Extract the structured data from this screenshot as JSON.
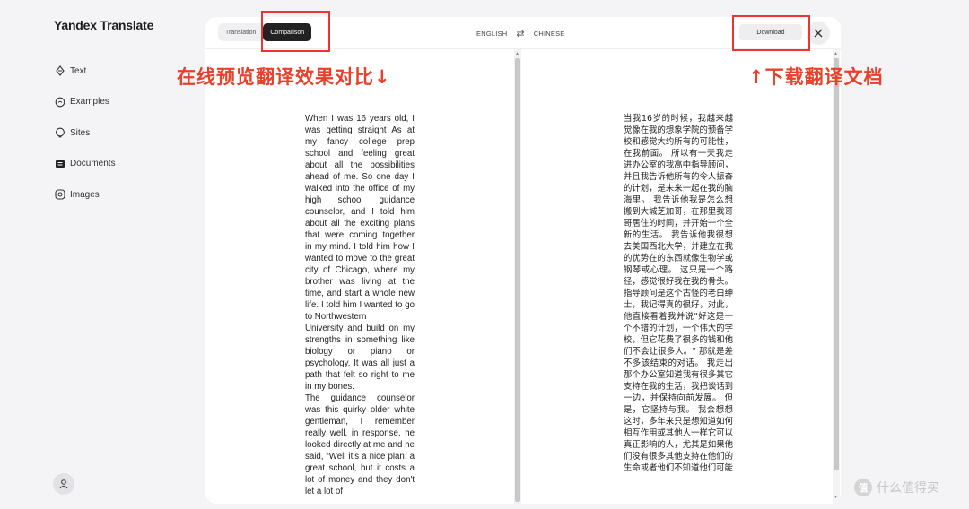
{
  "app": {
    "title": "Yandex Translate"
  },
  "sidebar": {
    "items": [
      {
        "label": "Text",
        "icon": "text-icon"
      },
      {
        "label": "Examples",
        "icon": "examples-icon"
      },
      {
        "label": "Sites",
        "icon": "sites-icon"
      },
      {
        "label": "Documents",
        "icon": "documents-icon",
        "active": true
      },
      {
        "label": "Images",
        "icon": "images-icon"
      }
    ]
  },
  "toolbar": {
    "tab_translation": "Translation",
    "tab_comparison": "Comparison",
    "source_lang": "ENGLISH",
    "target_lang": "CHINESE",
    "download_label": "Download"
  },
  "annotations": {
    "left_text": "在线预览翻译效果对比↓",
    "right_text": "↑下载翻译文档",
    "color": "#e8402a"
  },
  "document": {
    "en": [
      "When I was 16 years old, I was getting straight As at my fancy college prep school and feeling great about all the possibilities ahead of me. So one day I walked into the office of my high school guidance counselor, and I told him about all the exciting plans that were coming together in my mind. I told him how I wanted to move to the great city of Chicago, where my brother was living at the time, and start a whole new life. I told him I wanted to go to Northwestern",
      "University and build on my strengths in something like biology or piano or psychology. It was all just a path that felt so right to me in my bones.",
      "The guidance counselor was this quirky older white gentleman, I remember really well, in response, he looked directly at me and he said, “Well it's a nice plan, a great school, but it costs a lot of money and they don't let a lot of"
    ],
    "zh": [
      "当我16岁的时候，我越来越觉像在我的想象学院的预备学校和感觉大约所有的可能性，在我前面。 所以有一天我走进办公室的我高中指导顾问，并且我告诉他所有的令人振奋的计划，是未来一起在我的脑海里。 我告诉他我是怎么想搬到大城芝加哥，在那里我哥哥居住的时间，并开始一个全新的生活。 我告诉他我很想去美国西北大学，并建立在我的优势在的东西就像生物学或钢琴或心理。 这只是一个路径，感觉很好我在我的骨头。",
      "指导顾问是这个古怪的老白绅士，我记得真的很好，对此，他直接看着我并说\"好这是一个不错的计划，一个伟大的学校，但它花费了很多的钱和他们不会让很多人。\" 那就是差不多该结束的对话。 我走出那个办公室知道我有很多其它支持在我的生活，我把谈话到一边，并保持向前发展。 但是，它坚持与我。 我会想想这时，多年来只是想知道如何相互作用或其他人一样它可以真正影响的人，尤其是如果他们没有很多其他支持在他们的生命或者他们不知道他们可能"
    ]
  },
  "watermark": {
    "badge": "值",
    "text": "什么值得买"
  }
}
